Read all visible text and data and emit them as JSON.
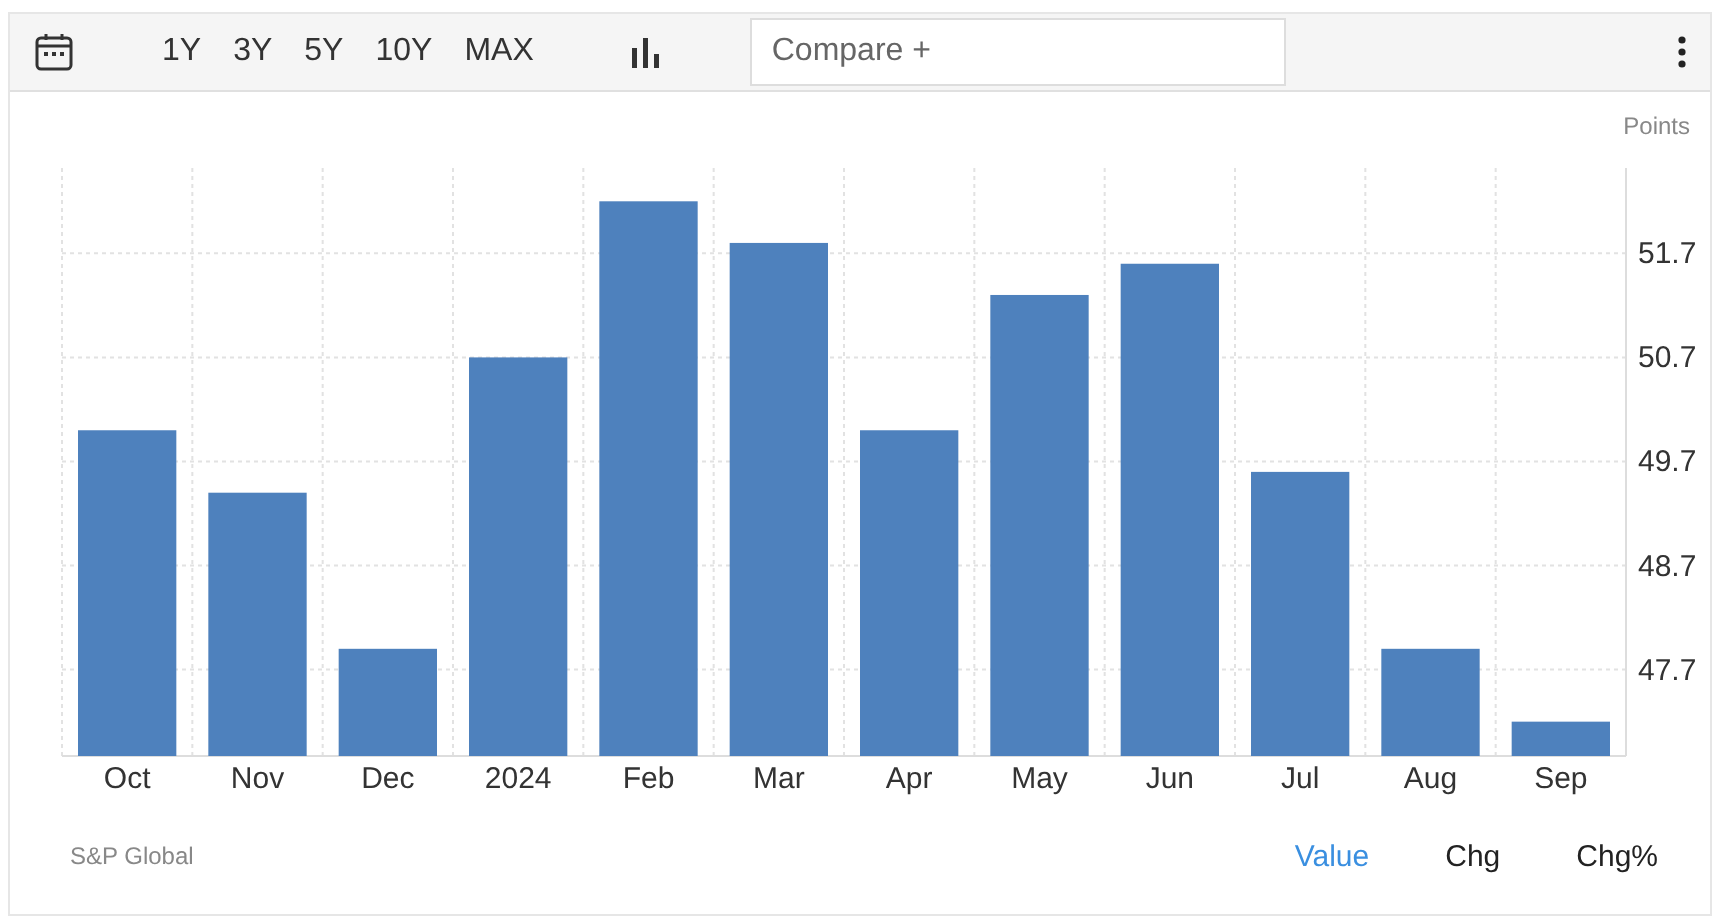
{
  "toolbar": {
    "ranges": [
      "1Y",
      "3Y",
      "5Y",
      "10Y",
      "MAX"
    ],
    "compare": {
      "placeholder": "Compare +"
    }
  },
  "chart": {
    "chart_data": {
      "type": "bar",
      "ylabel": "Points",
      "categories": [
        "Oct",
        "Nov",
        "Dec",
        "2024",
        "Feb",
        "Mar",
        "Apr",
        "May",
        "Jun",
        "Jul",
        "Aug",
        "Sep"
      ],
      "grid": true,
      "series": [
        {
          "color": "#4e81bd",
          "values": [
            50.0,
            49.4,
            47.9,
            50.7,
            52.2,
            51.8,
            50.0,
            51.3,
            51.6,
            49.6,
            47.9,
            47.2
          ]
        }
      ],
      "ylim": [
        46.87,
        52.52
      ],
      "yticks": [
        47.7,
        48.7,
        49.7,
        50.7,
        51.7
      ]
    }
  },
  "footer": {
    "source": "S&P Global",
    "modes": [
      {
        "label": "Value",
        "selected": true
      },
      {
        "label": "Chg",
        "selected": false
      },
      {
        "label": "Chg%",
        "selected": false
      }
    ]
  }
}
